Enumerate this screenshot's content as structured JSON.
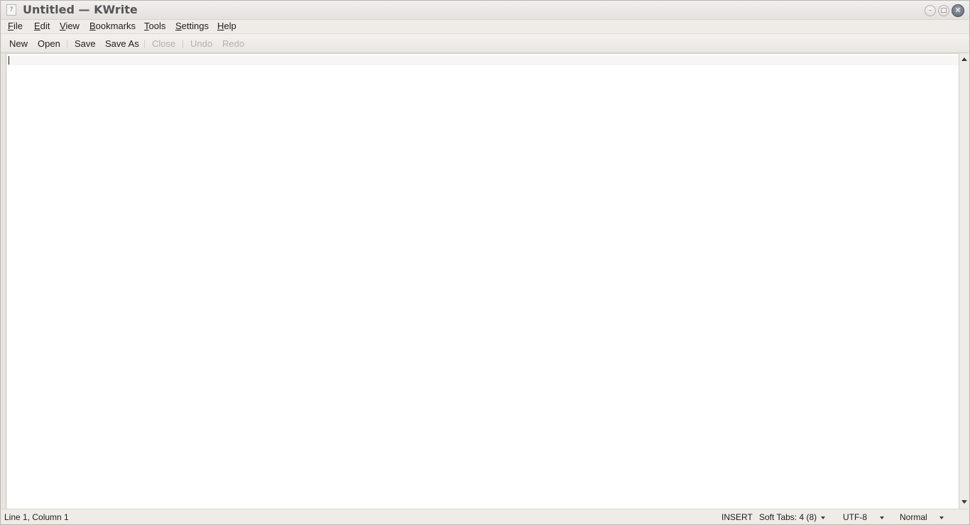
{
  "window": {
    "title_doc": "Untitled",
    "title_app": " — KWrite",
    "app_icon_glyph": "?",
    "minimize_glyph": "–",
    "maximize_glyph": "□",
    "close_glyph": "✕"
  },
  "menubar": {
    "items": [
      {
        "acc": "F",
        "rest": "ile"
      },
      {
        "acc": "E",
        "rest": "dit"
      },
      {
        "acc": "V",
        "rest": "iew"
      },
      {
        "acc": "B",
        "rest": "ookmarks"
      },
      {
        "acc": "T",
        "rest": "ools"
      },
      {
        "acc": "S",
        "rest": "ettings"
      },
      {
        "acc": "H",
        "rest": "elp"
      }
    ]
  },
  "toolbar": {
    "new_label": "New",
    "open_label": "Open",
    "save_label": "Save",
    "save_as_label": "Save As",
    "close_label": "Close",
    "undo_label": "Undo",
    "redo_label": "Redo"
  },
  "statusbar": {
    "cursor_position": "Line 1, Column 1",
    "input_mode": "INSERT",
    "indentation": "Soft Tabs: 4 (8)",
    "encoding": "UTF-8",
    "syntax_mode": "Normal"
  },
  "colors": {
    "window_bg": "#efebe7",
    "editor_bg": "#ffffff",
    "current_line": "#f7f6f4",
    "disabled_text": "#b3b0ad",
    "close_button": "#5d6470"
  }
}
